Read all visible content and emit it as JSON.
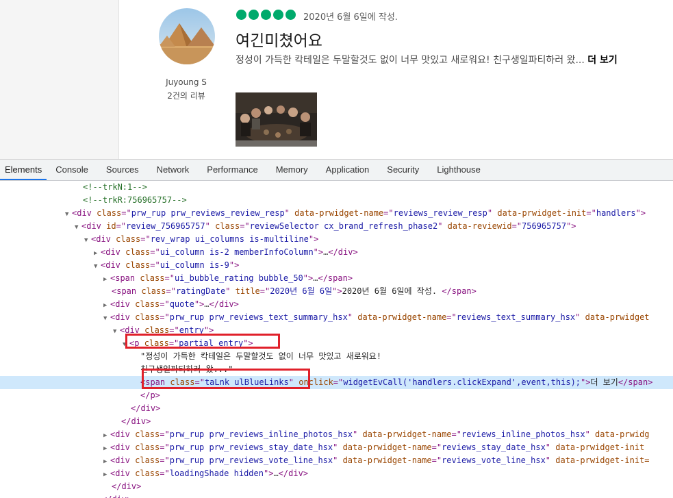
{
  "review": {
    "username": "Juyoung S",
    "review_count": "2건의 리뷰",
    "rating_bubbles": 5,
    "rating_color": "#00aa6c",
    "date": "2020년 6월 6일에 작성.",
    "title": "여긴미쳤어요",
    "text": "정성이 가득한 칵테일은 두말할것도 없이 너무 맛있고 새로워요! 친구생일파티하러 왔...",
    "more_link": "더 보기"
  },
  "devtools": {
    "tabs": [
      "Elements",
      "Console",
      "Sources",
      "Network",
      "Performance",
      "Memory",
      "Application",
      "Security",
      "Lighthouse"
    ],
    "active_tab": "Elements",
    "accent": "#1a73e8",
    "highlight_color": "#e0202a",
    "lines": [
      {
        "indent": 121,
        "tri": "",
        "html": "<span class='cm'>&lt;!--trkN:1--&gt;</span>"
      },
      {
        "indent": 121,
        "tri": "",
        "html": "<span class='cm'>&lt;!--trkR:756965757--&gt;</span>"
      },
      {
        "indent": 107,
        "tri": "▼",
        "html": "<span class='tg'>&lt;div </span><span class='an'>class</span><span class='tg'>=\"</span><span class='av'>prw_rup prw_reviews_review_resp</span><span class='tg'>\" </span><span class='an'>data-prwidget-name</span><span class='tg'>=\"</span><span class='av'>reviews_review_resp</span><span class='tg'>\" </span><span class='an'>data-prwidget-init</span><span class='tg'>=\"</span><span class='av'>handlers</span><span class='tg'>\"&gt;</span>"
      },
      {
        "indent": 121,
        "tri": "▼",
        "html": "<span class='tg'>&lt;div </span><span class='an'>id</span><span class='tg'>=\"</span><span class='av'>review_756965757</span><span class='tg'>\" </span><span class='an'>class</span><span class='tg'>=\"</span><span class='av'>reviewSelector cx_brand_refresh_phase2</span><span class='tg'>\" </span><span class='an'>data-reviewid</span><span class='tg'>=\"</span><span class='av'>756965757</span><span class='tg'>\"&gt;</span>"
      },
      {
        "indent": 135,
        "tri": "▼",
        "html": "<span class='tg'>&lt;div </span><span class='an'>class</span><span class='tg'>=\"</span><span class='av'>rev_wrap ui_columns is-multiline</span><span class='tg'>\"&gt;</span>"
      },
      {
        "indent": 149,
        "tri": "▶",
        "html": "<span class='tg'>&lt;div </span><span class='an'>class</span><span class='tg'>=\"</span><span class='av'>ui_column is-2 memberInfoColumn</span><span class='tg'>\"&gt;</span><span class='ell'>…</span><span class='tg'>&lt;/div&gt;</span>"
      },
      {
        "indent": 149,
        "tri": "▼",
        "html": "<span class='tg'>&lt;div </span><span class='an'>class</span><span class='tg'>=\"</span><span class='av'>ui_column is-9</span><span class='tg'>\"&gt;</span>"
      },
      {
        "indent": 163,
        "tri": "▶",
        "html": "<span class='tg'>&lt;span </span><span class='an'>class</span><span class='tg'>=\"</span><span class='av'>ui_bubble_rating bubble_50</span><span class='tg'>\"&gt;</span><span class='ell'>…</span><span class='tg'>&lt;/span&gt;</span>"
      },
      {
        "indent": 163,
        "tri": "",
        "html": "<span class='tg'>&lt;span </span><span class='an'>class</span><span class='tg'>=\"</span><span class='av'>ratingDate</span><span class='tg'>\" </span><span class='an'>title</span><span class='tg'>=\"</span><span class='av'>2020년 6월 6일</span><span class='tg'>\"&gt;</span><span class='tx'>2020년 6월 6일에 작성. </span><span class='tg'>&lt;/span&gt;</span>"
      },
      {
        "indent": 163,
        "tri": "▶",
        "html": "<span class='tg'>&lt;div </span><span class='an'>class</span><span class='tg'>=\"</span><span class='av'>quote</span><span class='tg'>\"&gt;</span><span class='ell'>…</span><span class='tg'>&lt;/div&gt;</span>"
      },
      {
        "indent": 163,
        "tri": "▼",
        "html": "<span class='tg'>&lt;div </span><span class='an'>class</span><span class='tg'>=\"</span><span class='av'>prw_rup prw_reviews_text_summary_hsx</span><span class='tg'>\" </span><span class='an'>data-prwidget-name</span><span class='tg'>=\"</span><span class='av'>reviews_text_summary_hsx</span><span class='tg'>\" </span><span class='an'>data-prwidget</span>"
      },
      {
        "indent": 177,
        "tri": "▼",
        "html": "<span class='tg'>&lt;div </span><span class='an'>class</span><span class='tg'>=\"</span><span class='av'>entry</span><span class='tg'>\"&gt;</span>"
      },
      {
        "indent": 191,
        "tri": "▼",
        "html": "<span class='tg'>&lt;p </span><span class='an'>class</span><span class='tg'>=\"</span><span class='av'>partial_entry</span><span class='tg'>\"&gt;</span>"
      },
      {
        "indent": 205,
        "tri": "",
        "html": "<span class='tx'>\"정성이 가득한 칵테일은 두말할것도 없이 너무 맛있고 새로워요!</span>"
      },
      {
        "indent": 205,
        "tri": "",
        "html": "<span class='tx'>친구생일파티하러 왔...\"</span>"
      },
      {
        "indent": 205,
        "tri": "",
        "sel": true,
        "html": "<span class='tg'>&lt;span </span><span class='an'>class</span><span class='tg'>=\"</span><span class='av'>taLnk ulBlueLinks</span><span class='tg'>\" </span><span class='an'>onclick</span><span class='tg'>=\"</span><span class='av'>widgetEvCall('handlers.clickExpand',event,this);</span><span class='tg'>\"&gt;</span><span class='tx'>더 보기</span><span class='tg'>&lt;/span&gt;</span>"
      },
      {
        "indent": 205,
        "tri": "",
        "html": "<span class='tg'>&lt;/p&gt;</span>"
      },
      {
        "indent": 191,
        "tri": "",
        "html": "<span class='tg'>&lt;/div&gt;</span>"
      },
      {
        "indent": 177,
        "tri": "",
        "html": "<span class='tg'>&lt;/div&gt;</span>"
      },
      {
        "indent": 163,
        "tri": "▶",
        "html": "<span class='tg'>&lt;div </span><span class='an'>class</span><span class='tg'>=\"</span><span class='av'>prw_rup prw_reviews_inline_photos_hsx</span><span class='tg'>\" </span><span class='an'>data-prwidget-name</span><span class='tg'>=\"</span><span class='av'>reviews_inline_photos_hsx</span><span class='tg'>\" </span><span class='an'>data-prwidg</span>"
      },
      {
        "indent": 163,
        "tri": "▶",
        "html": "<span class='tg'>&lt;div </span><span class='an'>class</span><span class='tg'>=\"</span><span class='av'>prw_rup prw_reviews_stay_date_hsx</span><span class='tg'>\" </span><span class='an'>data-prwidget-name</span><span class='tg'>=\"</span><span class='av'>reviews_stay_date_hsx</span><span class='tg'>\" </span><span class='an'>data-prwidget-init</span>"
      },
      {
        "indent": 163,
        "tri": "▶",
        "html": "<span class='tg'>&lt;div </span><span class='an'>class</span><span class='tg'>=\"</span><span class='av'>prw_rup prw_reviews_vote_line_hsx</span><span class='tg'>\" </span><span class='an'>data-prwidget-name</span><span class='tg'>=\"</span><span class='av'>reviews_vote_line_hsx</span><span class='tg'>\" </span><span class='an'>data-prwidget-init=</span>"
      },
      {
        "indent": 163,
        "tri": "▶",
        "html": "<span class='tg'>&lt;div </span><span class='an'>class</span><span class='tg'>=\"</span><span class='av'>loadingShade hidden</span><span class='tg'>\"&gt;</span><span class='ell'>…</span><span class='tg'>&lt;/div&gt;</span>"
      },
      {
        "indent": 163,
        "tri": "",
        "html": "<span class='tg'>&lt;/div&gt;</span>"
      },
      {
        "indent": 149,
        "tri": "",
        "html": "<span class='tg'>&lt;/div&gt;</span>"
      }
    ]
  }
}
